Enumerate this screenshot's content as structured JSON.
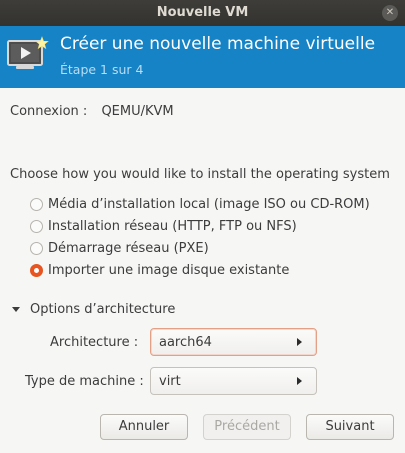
{
  "window": {
    "title": "Nouvelle VM"
  },
  "header": {
    "title": "Créer une nouvelle machine virtuelle",
    "step": "Étape 1 sur 4",
    "icon": "monitor-star-icon",
    "background_color": "#1583c5"
  },
  "connection": {
    "label": "Connexion :",
    "value": "QEMU/KVM"
  },
  "install": {
    "question": "Choose how you would like to install the operating system",
    "options": [
      {
        "label": "Média d’installation local (image ISO ou CD-ROM)",
        "selected": false
      },
      {
        "label": "Installation réseau (HTTP, FTP ou NFS)",
        "selected": false
      },
      {
        "label": "Démarrage réseau (PXE)",
        "selected": false
      },
      {
        "label": "Importer une image disque existante",
        "selected": true
      }
    ]
  },
  "architecture": {
    "expander_label": "Options d’architecture",
    "expanded": true,
    "arch_label": "Architecture :",
    "arch_value": "aarch64",
    "machine_label": "Type de machine :",
    "machine_value": "virt"
  },
  "buttons": {
    "cancel": "Annuler",
    "previous": "Précédent",
    "next": "Suivant"
  },
  "colors": {
    "accent": "#e95420",
    "titlebar": "#3a3935"
  }
}
